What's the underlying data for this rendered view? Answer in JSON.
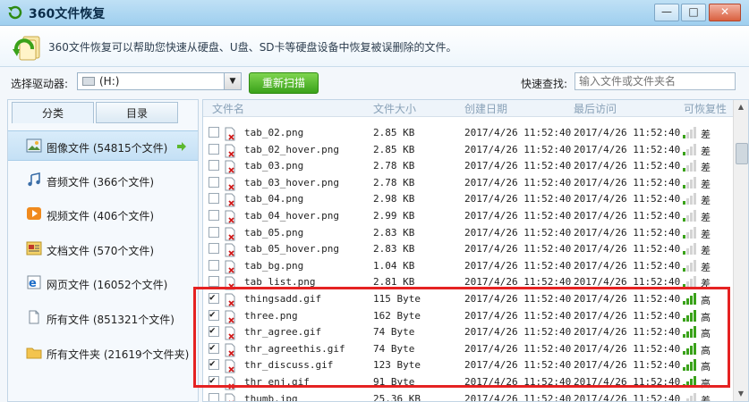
{
  "window": {
    "title": "360文件恢复",
    "min_label": "—",
    "max_label": "□",
    "close_label": "✕"
  },
  "banner": {
    "text": "360文件恢复可以帮助您快速从硬盘、U盘、SD卡等硬盘设备中恢复被误删除的文件。"
  },
  "drive": {
    "label": "选择驱动器:",
    "value": "(H:)",
    "rescan_label": "重新扫描"
  },
  "search": {
    "label": "快速查找:",
    "placeholder": "输入文件或文件夹名"
  },
  "tabs": {
    "category": "分类",
    "directory": "目录"
  },
  "categories": [
    {
      "label": "图像文件 (54815个文件)",
      "icon": "image-icon"
    },
    {
      "label": "音频文件 (366个文件)",
      "icon": "music-icon"
    },
    {
      "label": "视频文件 (406个文件)",
      "icon": "video-icon"
    },
    {
      "label": "文档文件 (570个文件)",
      "icon": "document-icon"
    },
    {
      "label": "网页文件 (16052个文件)",
      "icon": "web-icon"
    },
    {
      "label": "所有文件 (851321个文件)",
      "icon": "file-icon"
    },
    {
      "label": "所有文件夹 (21619个文件夹)",
      "icon": "folder-icon"
    }
  ],
  "columns": {
    "name": "文件名",
    "size": "文件大小",
    "created": "创建日期",
    "accessed": "最后访问",
    "recover": "可恢复性"
  },
  "files": [
    {
      "name": "tab_02.png",
      "size": "2.85 KB",
      "created": "2017/4/26 11:52:40",
      "accessed": "2017/4/26 11:52:40",
      "recover": "差",
      "checked": false,
      "level": 1
    },
    {
      "name": "tab_02_hover.png",
      "size": "2.85 KB",
      "created": "2017/4/26 11:52:40",
      "accessed": "2017/4/26 11:52:40",
      "recover": "差",
      "checked": false,
      "level": 1
    },
    {
      "name": "tab_03.png",
      "size": "2.78 KB",
      "created": "2017/4/26 11:52:40",
      "accessed": "2017/4/26 11:52:40",
      "recover": "差",
      "checked": false,
      "level": 1
    },
    {
      "name": "tab_03_hover.png",
      "size": "2.78 KB",
      "created": "2017/4/26 11:52:40",
      "accessed": "2017/4/26 11:52:40",
      "recover": "差",
      "checked": false,
      "level": 1
    },
    {
      "name": "tab_04.png",
      "size": "2.98 KB",
      "created": "2017/4/26 11:52:40",
      "accessed": "2017/4/26 11:52:40",
      "recover": "差",
      "checked": false,
      "level": 1
    },
    {
      "name": "tab_04_hover.png",
      "size": "2.99 KB",
      "created": "2017/4/26 11:52:40",
      "accessed": "2017/4/26 11:52:40",
      "recover": "差",
      "checked": false,
      "level": 1
    },
    {
      "name": "tab_05.png",
      "size": "2.83 KB",
      "created": "2017/4/26 11:52:40",
      "accessed": "2017/4/26 11:52:40",
      "recover": "差",
      "checked": false,
      "level": 1
    },
    {
      "name": "tab_05_hover.png",
      "size": "2.83 KB",
      "created": "2017/4/26 11:52:40",
      "accessed": "2017/4/26 11:52:40",
      "recover": "差",
      "checked": false,
      "level": 1
    },
    {
      "name": "tab_bg.png",
      "size": "1.04 KB",
      "created": "2017/4/26 11:52:40",
      "accessed": "2017/4/26 11:52:40",
      "recover": "差",
      "checked": false,
      "level": 1
    },
    {
      "name": "tab_list.png",
      "size": "2.81 KB",
      "created": "2017/4/26 11:52:40",
      "accessed": "2017/4/26 11:52:40",
      "recover": "差",
      "checked": false,
      "level": 1
    },
    {
      "name": "thingsadd.gif",
      "size": "115 Byte",
      "created": "2017/4/26 11:52:40",
      "accessed": "2017/4/26 11:52:40",
      "recover": "高",
      "checked": true,
      "level": 4
    },
    {
      "name": "three.png",
      "size": "162 Byte",
      "created": "2017/4/26 11:52:40",
      "accessed": "2017/4/26 11:52:40",
      "recover": "高",
      "checked": true,
      "level": 4
    },
    {
      "name": "thr_agree.gif",
      "size": "74 Byte",
      "created": "2017/4/26 11:52:40",
      "accessed": "2017/4/26 11:52:40",
      "recover": "高",
      "checked": true,
      "level": 4
    },
    {
      "name": "thr_agreethis.gif",
      "size": "74 Byte",
      "created": "2017/4/26 11:52:40",
      "accessed": "2017/4/26 11:52:40",
      "recover": "高",
      "checked": true,
      "level": 4
    },
    {
      "name": "thr_discuss.gif",
      "size": "123 Byte",
      "created": "2017/4/26 11:52:40",
      "accessed": "2017/4/26 11:52:40",
      "recover": "高",
      "checked": true,
      "level": 4
    },
    {
      "name": "thr_enj.gif",
      "size": "91 Byte",
      "created": "2017/4/26 11:52:40",
      "accessed": "2017/4/26 11:52:40",
      "recover": "高",
      "checked": true,
      "level": 4
    },
    {
      "name": "thumb.jpg",
      "size": "25.36 KB",
      "created": "2017/4/26 11:52:40",
      "accessed": "2017/4/26 11:52:40",
      "recover": "差",
      "checked": false,
      "level": 1
    }
  ],
  "colors": {
    "signal_on": "#3aa21a",
    "signal_off": "#d4d4d4",
    "highlight": "#e52222",
    "file_x": "#d11a1a"
  }
}
